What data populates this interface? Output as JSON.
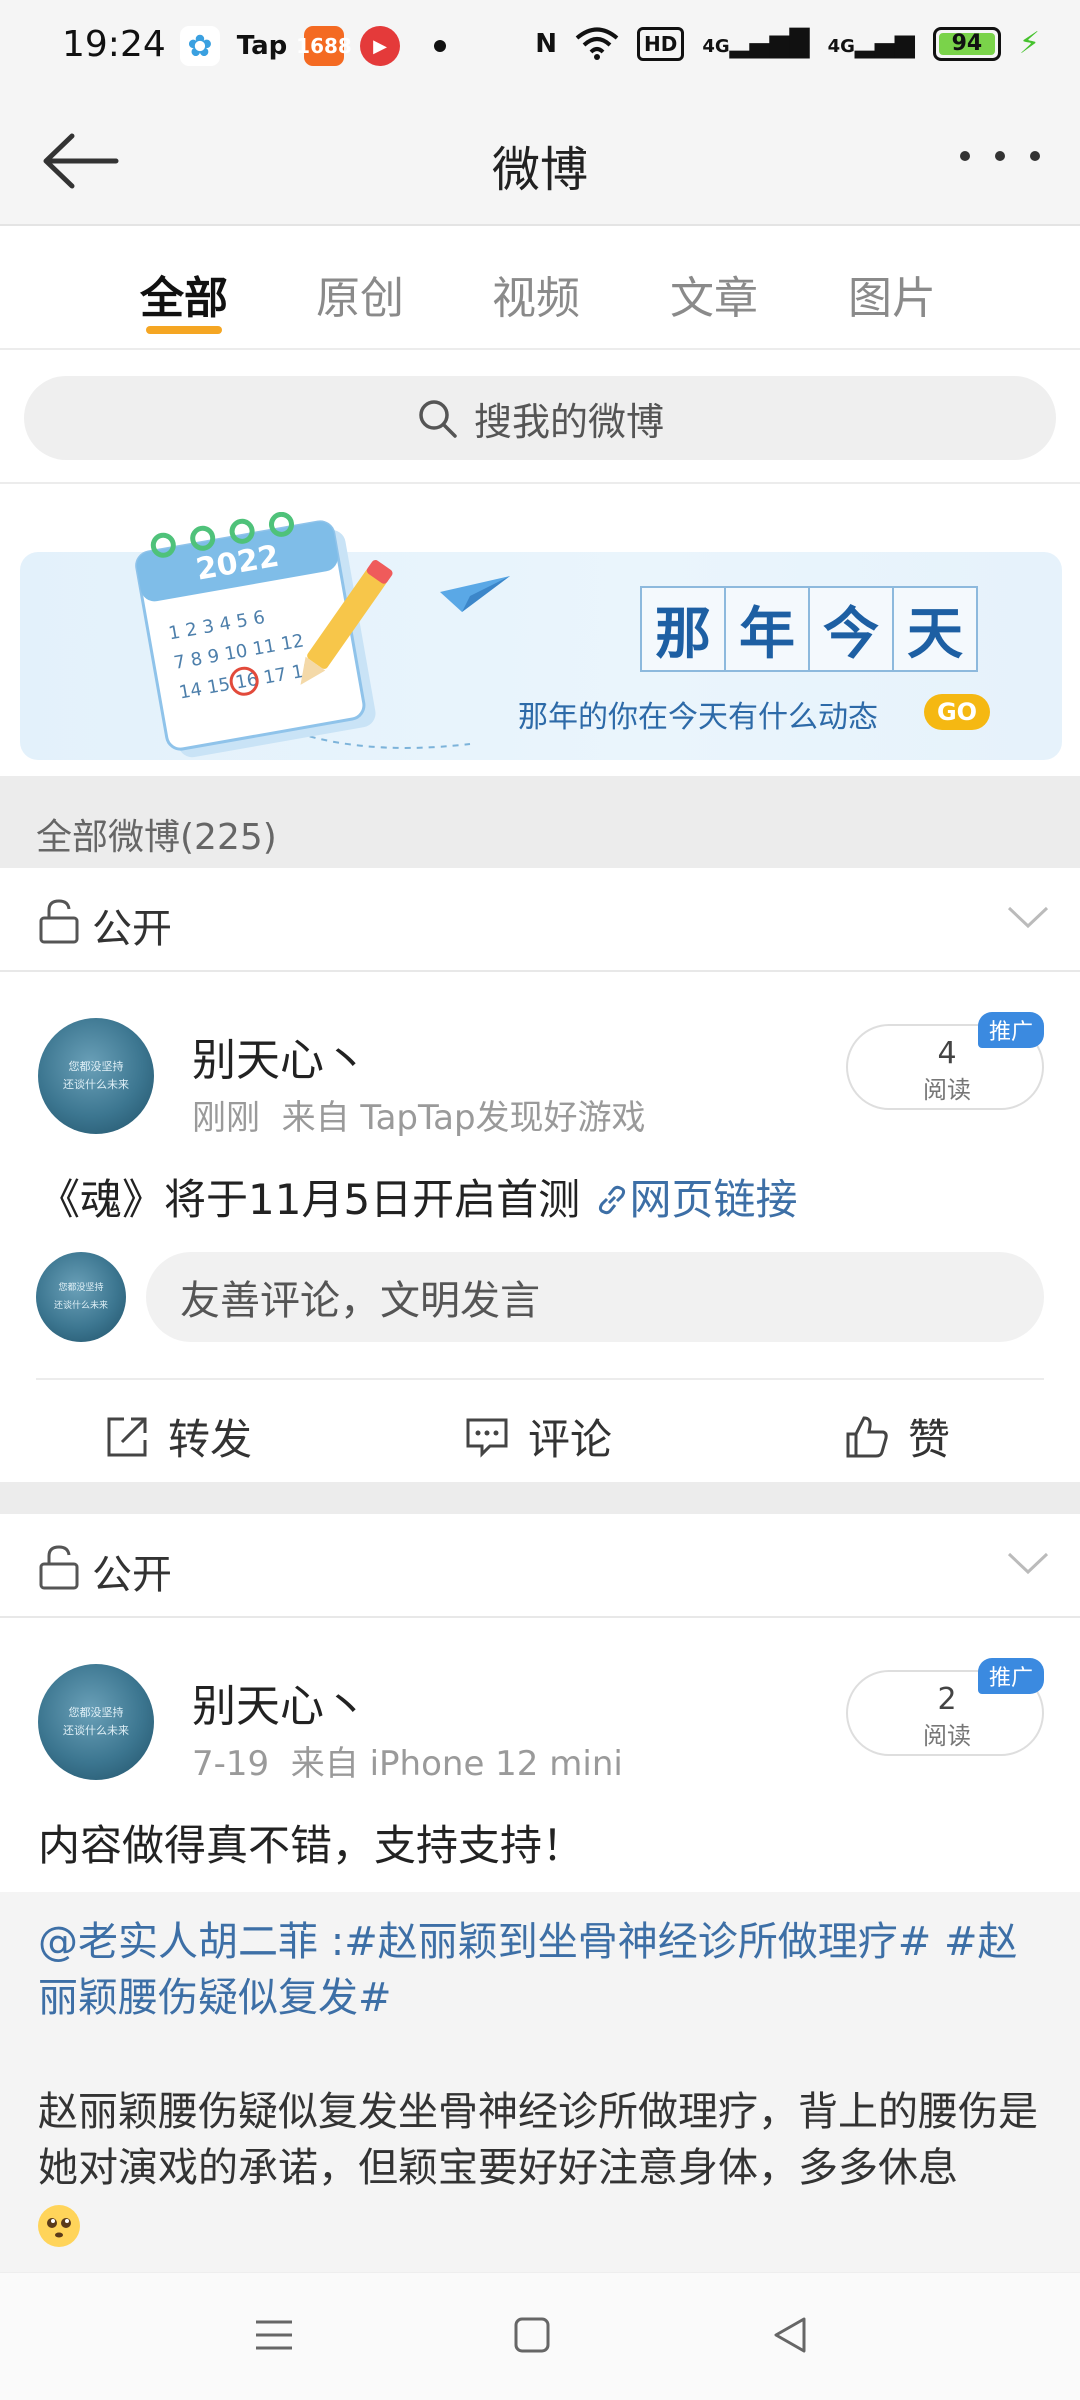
{
  "status_bar": {
    "time": "19:24",
    "apps": [
      "pinwheel-app",
      "Tap",
      "1688",
      "video-app"
    ],
    "tap_label": "Tap",
    "app3_label": "1688",
    "hd_label": "HD",
    "net1_label": "4G",
    "net2_label": "4G",
    "battery_level": "94"
  },
  "navbar": {
    "title": "微博"
  },
  "tabs": [
    {
      "label": "全部",
      "active": true
    },
    {
      "label": "原创",
      "active": false
    },
    {
      "label": "视频",
      "active": false
    },
    {
      "label": "文章",
      "active": false
    },
    {
      "label": "图片",
      "active": false
    }
  ],
  "search": {
    "placeholder": "搜我的微博"
  },
  "banner": {
    "calendar_year": "2022",
    "title_chars": [
      "那",
      "年",
      "今",
      "天"
    ],
    "subtitle": "那年的你在今天有什么动态",
    "go_label": "GO"
  },
  "section_header": "全部微博(225)",
  "posts": [
    {
      "visibility": "公开",
      "author": "别天心丶",
      "time": "刚刚",
      "source": "来自 TapTap发现好游戏",
      "read_count": "4",
      "read_label": "阅读",
      "promo_label": "推广",
      "text": "《魂》将于11月5日开启首测",
      "link_text": "网页链接",
      "avatar_text": [
        "您都没坚持",
        "还谈什么未来"
      ]
    },
    {
      "visibility": "公开",
      "author": "别天心丶",
      "time": "7-19",
      "source": "来自 iPhone 12 mini",
      "read_count": "2",
      "read_label": "阅读",
      "promo_label": "推广",
      "text": "内容做得真不错，支持支持！",
      "avatar_text": [
        "您都没坚持",
        "还谈什么未来"
      ],
      "quote": {
        "mention": "@老实人胡二菲",
        "separator": " :",
        "topic1": "#赵丽颖到坐骨神经诊所做理疗#",
        "topic2": " #赵丽颖腰伤疑似复发#",
        "body": "赵丽颖腰伤疑似复发坐骨神经诊所做理疗，背上的腰伤是她对演戏的承诺，但颖宝要好好注意身体，多多休息"
      }
    }
  ],
  "comment_placeholder": "友善评论，文明发言",
  "actions": {
    "forward": "转发",
    "comment": "评论",
    "like": "赞"
  }
}
